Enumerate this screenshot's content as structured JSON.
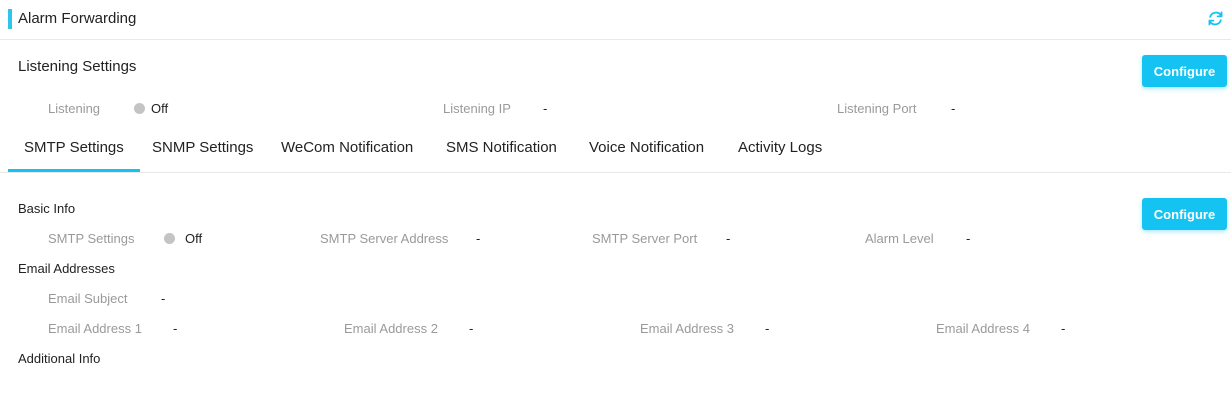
{
  "header": {
    "title": "Alarm Forwarding",
    "refresh_icon": "refresh-icon",
    "accent": "#2dc5ee"
  },
  "listening": {
    "title": "Listening Settings",
    "configure_label": "Configure",
    "listening_label": "Listening",
    "listening_value": "Off",
    "ip_label": "Listening IP",
    "ip_value": "-",
    "port_label": "Listening Port",
    "port_value": "-"
  },
  "tabs": [
    {
      "label": "SMTP Settings",
      "active": true
    },
    {
      "label": "SNMP Settings",
      "active": false
    },
    {
      "label": "WeCom Notification",
      "active": false
    },
    {
      "label": "SMS Notification",
      "active": false
    },
    {
      "label": "Voice Notification",
      "active": false
    },
    {
      "label": "Activity Logs",
      "active": false
    }
  ],
  "smtp": {
    "configure_label": "Configure",
    "basic_info": "Basic Info",
    "smtp_settings_label": "SMTP Settings",
    "smtp_settings_value": "Off",
    "server_address_label": "SMTP Server Address",
    "server_address_value": "-",
    "server_port_label": "SMTP Server Port",
    "server_port_value": "-",
    "alarm_level_label": "Alarm Level",
    "alarm_level_value": "-",
    "email_addresses": "Email Addresses",
    "email_subject_label": "Email Subject",
    "email_subject_value": "-",
    "email1_label": "Email Address 1",
    "email1_value": "-",
    "email2_label": "Email Address 2",
    "email2_value": "-",
    "email3_label": "Email Address 3",
    "email3_value": "-",
    "email4_label": "Email Address 4",
    "email4_value": "-",
    "additional_info": "Additional Info"
  },
  "colors": {
    "primary": "#14c3f2",
    "status_off": "#c4c4c4",
    "label": "#9a9a9a"
  }
}
